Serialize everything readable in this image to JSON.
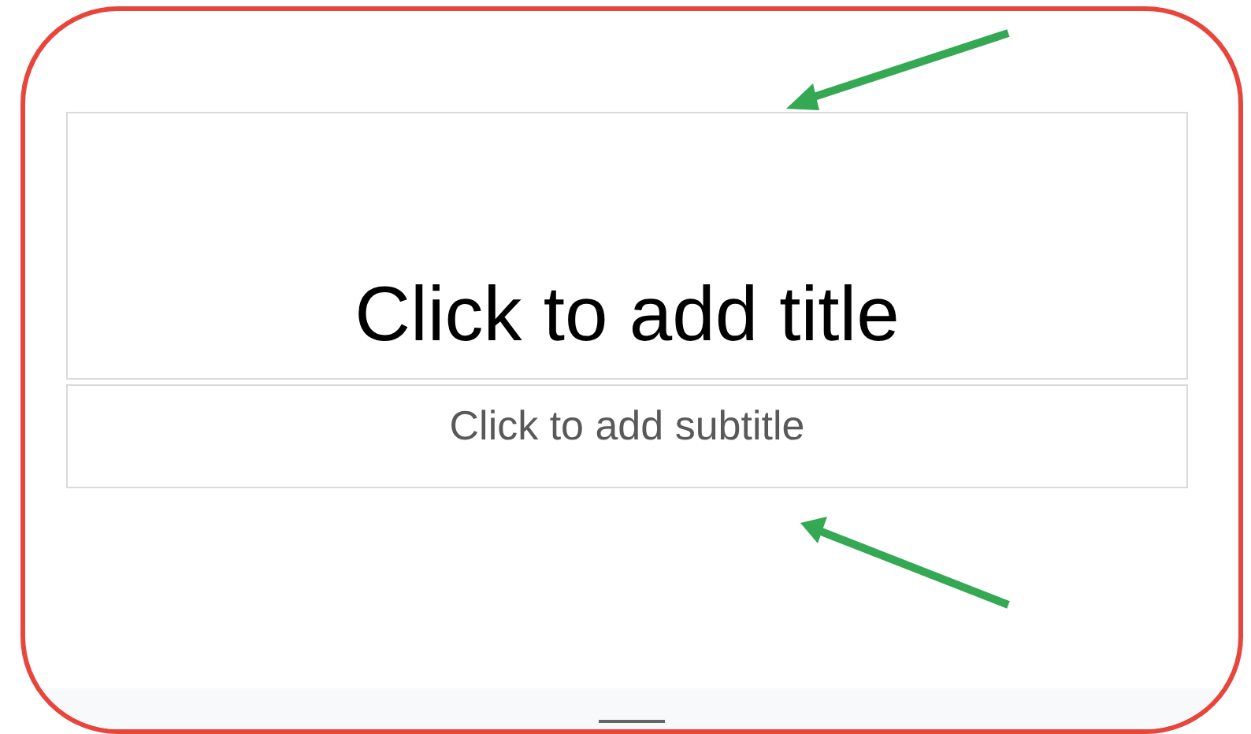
{
  "slide": {
    "title": {
      "placeholder": "Click to add title"
    },
    "subtitle": {
      "placeholder": "Click to add subtitle"
    }
  }
}
